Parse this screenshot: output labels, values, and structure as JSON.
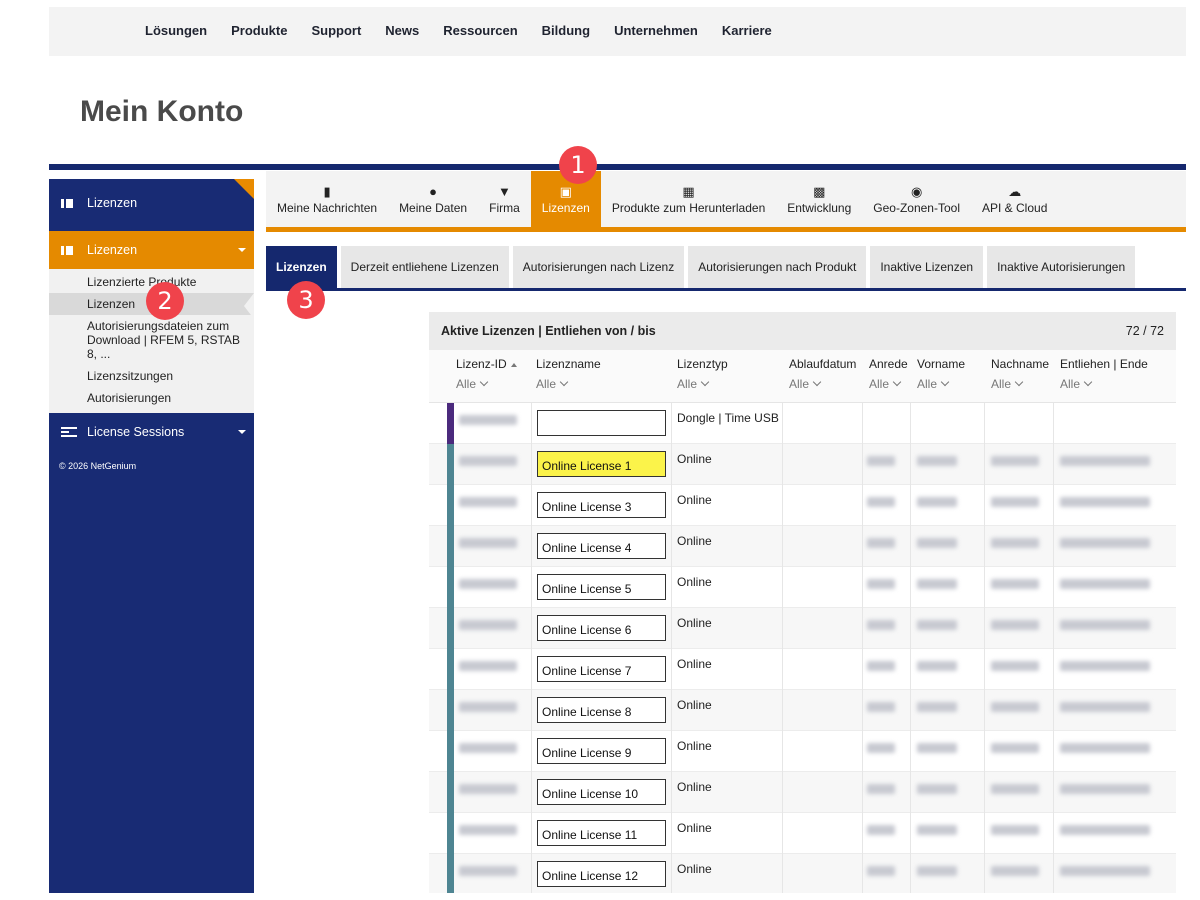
{
  "topnav": {
    "items": [
      "Lösungen",
      "Produkte",
      "Support",
      "News",
      "Ressourcen",
      "Bildung",
      "Unternehmen",
      "Karriere"
    ]
  },
  "page": {
    "title": "Mein Konto"
  },
  "sidebar": {
    "header_label": "Lizenzen",
    "active_label": "Lizenzen",
    "sub_items": [
      "Lizenzierte Produkte",
      "Lizenzen",
      "Autorisierungsdateien zum Download | RFEM 5, RSTAB 8, ...",
      "Lizenzsitzungen",
      "Autorisierungen"
    ],
    "sessions_label": "License Sessions",
    "copyright": "© 2026 NetGenium"
  },
  "main_tabs": [
    {
      "label": "Meine Nachrichten",
      "icon": "id-card-icon"
    },
    {
      "label": "Meine Daten",
      "icon": "person-icon"
    },
    {
      "label": "Firma",
      "icon": "map-pin-icon"
    },
    {
      "label": "Lizenzen",
      "icon": "license-icon"
    },
    {
      "label": "Produkte zum Herunterladen",
      "icon": "library-icon"
    },
    {
      "label": "Entwicklung",
      "icon": "widgets-icon"
    },
    {
      "label": "Geo-Zonen-Tool",
      "icon": "globe-icon"
    },
    {
      "label": "API & Cloud",
      "icon": "cloud-icon"
    }
  ],
  "sub_tabs": [
    "Lizenzen",
    "Derzeit entliehene Lizenzen",
    "Autorisierungen nach Lizenz",
    "Autorisierungen nach Produkt",
    "Inaktive Lizenzen",
    "Inaktive Autorisierungen"
  ],
  "grid": {
    "title": "Aktive Lizenzen | Entliehen von / bis",
    "count": "72 / 72",
    "columns": [
      "Lizenz-ID",
      "Lizenzname",
      "Lizenztyp",
      "Ablaufdatum",
      "Anrede",
      "Vorname",
      "Nachname",
      "Entliehen | Ende"
    ],
    "filter_label": "Alle",
    "rows": [
      {
        "name": "",
        "type": "Dongle | Time USB",
        "stripe": "#4b2a7d"
      },
      {
        "name": "Online License 1",
        "type": "Online",
        "stripe": "#4e8592"
      },
      {
        "name": "Online License 3",
        "type": "Online",
        "stripe": "#4e8592"
      },
      {
        "name": "Online License 4",
        "type": "Online",
        "stripe": "#4e8592"
      },
      {
        "name": "Online License 5",
        "type": "Online",
        "stripe": "#4e8592"
      },
      {
        "name": "Online License 6",
        "type": "Online",
        "stripe": "#4e8592"
      },
      {
        "name": "Online License 7",
        "type": "Online",
        "stripe": "#4e8592"
      },
      {
        "name": "Online License 8",
        "type": "Online",
        "stripe": "#4e8592"
      },
      {
        "name": "Online License 9",
        "type": "Online",
        "stripe": "#4e8592"
      },
      {
        "name": "Online License 10",
        "type": "Online",
        "stripe": "#4e8592"
      },
      {
        "name": "Online License 11",
        "type": "Online",
        "stripe": "#4e8592"
      },
      {
        "name": "Online License 12",
        "type": "Online",
        "stripe": "#4e8592"
      }
    ]
  },
  "callouts": [
    "1",
    "2",
    "3"
  ]
}
